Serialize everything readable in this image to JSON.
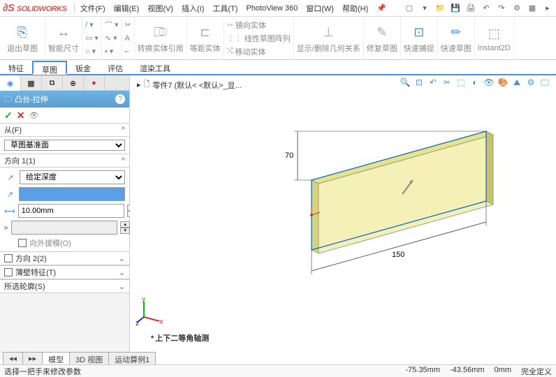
{
  "app": {
    "logo_text": "SOLIDWORKS"
  },
  "menu": {
    "items": [
      "文件(F)",
      "编辑(E)",
      "视图(V)",
      "插入(I)",
      "工具(T)",
      "PhotoView 360",
      "窗口(W)",
      "帮助(H)"
    ]
  },
  "ribbon": {
    "exit_sketch": "退出草图",
    "smart_dim": "智能尺寸",
    "convert": "转换实体引用",
    "offset": "等距实体",
    "mirror": "镜向实体",
    "linear_pattern": "线性草图阵列",
    "move": "移动实体",
    "display_del": "显示/删除几何关系",
    "repair": "修复草图",
    "quick_snap": "快速捕捉",
    "quick_sketch": "快速草图",
    "instant2d": "Instant2D"
  },
  "tabs": {
    "items": [
      "特征",
      "草图",
      "钣金",
      "评估",
      "渲染工具"
    ],
    "active_index": 1
  },
  "feature": {
    "title": "凸台-拉伸",
    "from": {
      "label": "从(F)",
      "value": "草图基准面"
    },
    "dir1": {
      "label": "方向 1(1)",
      "end_condition": "给定深度",
      "blind_value": "",
      "depth": "10.00mm",
      "draft_enabled": false,
      "draft_label": "向外拔模(O)"
    },
    "dir2": {
      "label": "方向 2(2)",
      "enabled": false
    },
    "thin": {
      "label": "薄壁特征(T)",
      "enabled": false
    },
    "contours": {
      "label": "所选轮廓(S)"
    }
  },
  "viewport": {
    "breadcrumb": "零件7  (默认< <默认>_显...",
    "dim_width": "150",
    "dim_height": "70",
    "orientation_label": "上下二等角轴测"
  },
  "bottom_tabs": {
    "items": [
      "模型",
      "3D 视图",
      "运动算例1"
    ],
    "active_index": 0
  },
  "status": {
    "hint": "选择一把手来修改参数",
    "coord_x": "-75.35mm",
    "coord_y": "-43.56mm",
    "coord_z": "0mm",
    "mode": "完全定义"
  }
}
